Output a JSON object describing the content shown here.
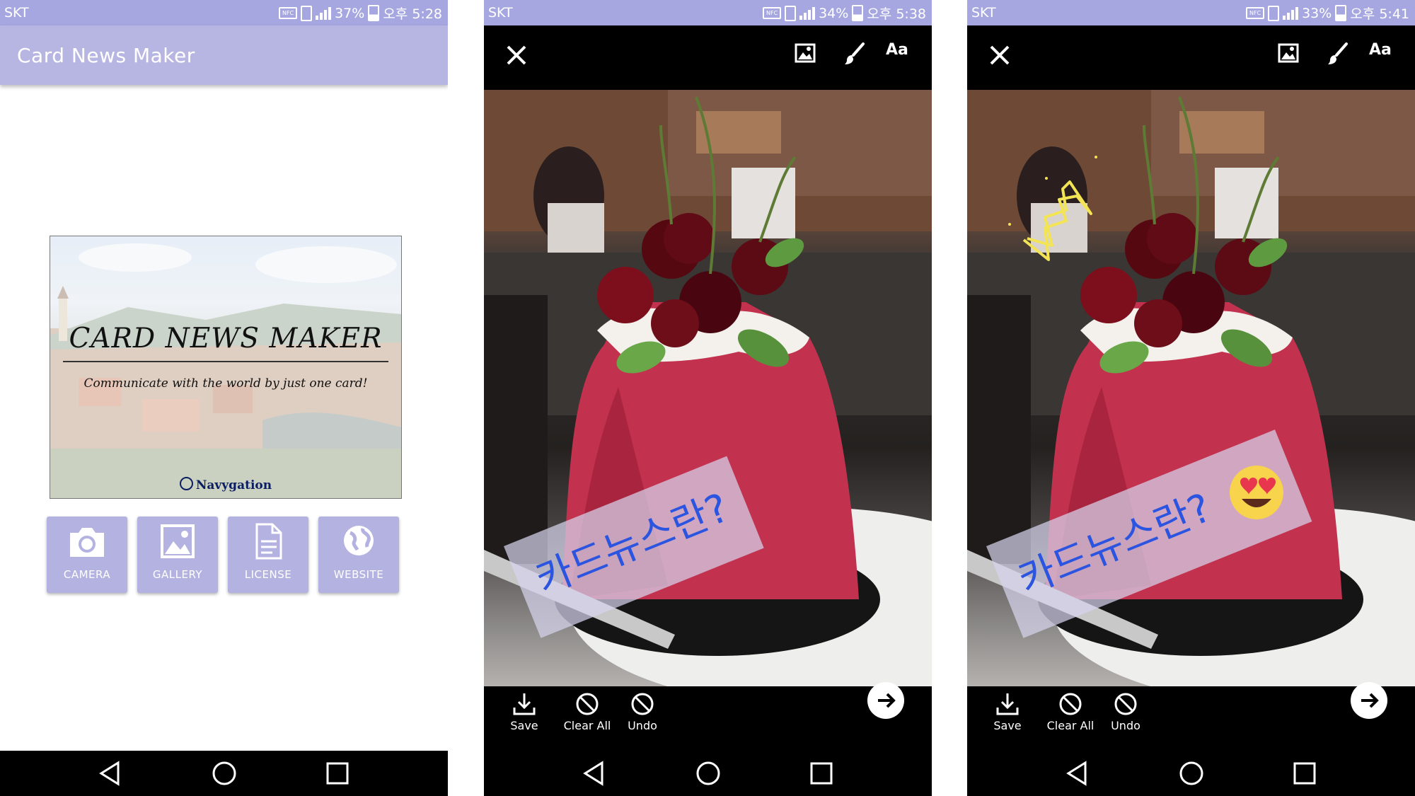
{
  "screens": [
    {
      "status": {
        "carrier": "SKT",
        "nfc": "NFC",
        "battery": "37%",
        "time": "오후 5:28"
      },
      "app_title": "Card News Maker",
      "card": {
        "title": "CARD NEWS MAKER",
        "subtitle": "Communicate with the world by just one card!",
        "brand": "Navygation"
      },
      "tiles": [
        {
          "label": "CAMERA",
          "icon": "camera-icon"
        },
        {
          "label": "GALLERY",
          "icon": "gallery-icon"
        },
        {
          "label": "LICENSE",
          "icon": "document-icon"
        },
        {
          "label": "WEBSITE",
          "icon": "globe-icon"
        }
      ]
    },
    {
      "status": {
        "carrier": "SKT",
        "nfc": "NFC",
        "battery": "34%",
        "time": "오후 5:38"
      },
      "toolbar": {
        "text_tool": "Aa"
      },
      "banner_text": "카드뉴스란?",
      "actions": {
        "save": "Save",
        "clear_all": "Clear All",
        "undo": "Undo"
      }
    },
    {
      "status": {
        "carrier": "SKT",
        "nfc": "NFC",
        "battery": "33%",
        "time": "오후 5:41"
      },
      "toolbar": {
        "text_tool": "Aa"
      },
      "banner_text": "카드뉴스란?",
      "actions": {
        "save": "Save",
        "clear_all": "Clear All",
        "undo": "Undo"
      }
    }
  ],
  "colors": {
    "status_bar": "#a6a7e0",
    "app_bar": "#b7b6e2",
    "tile": "#b3b2e0",
    "banner_text": "#2b55e0",
    "doodle": "#f2e455"
  }
}
